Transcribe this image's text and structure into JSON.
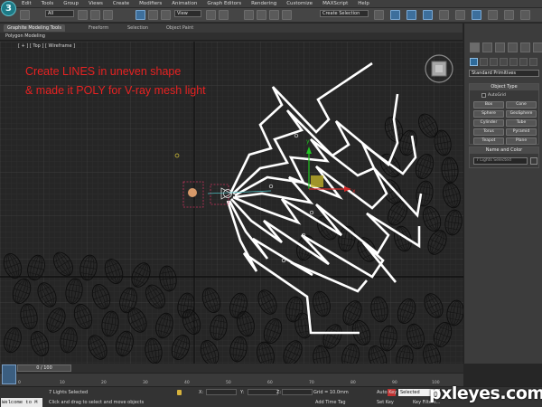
{
  "app": {
    "logo_text": "3"
  },
  "menubar": {
    "items": [
      "Edit",
      "Tools",
      "Group",
      "Views",
      "Create",
      "Modifiers",
      "Animation",
      "Graph Editors",
      "Rendering",
      "Customize",
      "MAXScript",
      "Help"
    ]
  },
  "toolbar": {
    "selection_filter": "All",
    "reference_coord": "View",
    "named_selection": "Create Selection"
  },
  "ribbon": {
    "tabs": [
      "Graphite Modeling Tools",
      "Freeform",
      "Selection",
      "Object Paint"
    ],
    "active_tab": "Graphite Modeling Tools",
    "sub_label": "Polygon Modeling"
  },
  "viewport": {
    "label": "[ + ] [ Top ] [ Wireframe ]",
    "annotation_line1": "Create LINES in uneven shape",
    "annotation_line2": "& made it POLY for V-ray mesh light",
    "annotation_color": "#e82222",
    "grid_color": "#3a3a3a",
    "line_color": "#ffffff"
  },
  "command_panel": {
    "dropdown": "Standard Primitives",
    "object_type_title": "Object Type",
    "autogrid_label": "AutoGrid",
    "objects": [
      "Box",
      "Cone",
      "Sphere",
      "GeoSphere",
      "Cylinder",
      "Tube",
      "Torus",
      "Pyramid",
      "Teapot",
      "Plane"
    ],
    "name_color_title": "Name and Color",
    "name_value": "7 Lights Selected"
  },
  "timeline": {
    "slider": "0 / 100",
    "ruler": [
      "0",
      "10",
      "20",
      "30",
      "40",
      "50",
      "60",
      "70",
      "80",
      "90",
      "100"
    ]
  },
  "status": {
    "welcome": "Welcome to M",
    "selection_info": "7 Lights Selected",
    "prompt": "Click and drag to select and move objects",
    "x_label": "X:",
    "y_label": "Y:",
    "z_label": "Z:",
    "grid_text": "Grid = 10.0mm",
    "add_time_tag": "Add Time Tag",
    "auto_key": "Auto Key",
    "set_key": "Set Key",
    "selected": "Selected",
    "key_filters": "Key Filters..."
  },
  "watermark": "pxleyes.com"
}
